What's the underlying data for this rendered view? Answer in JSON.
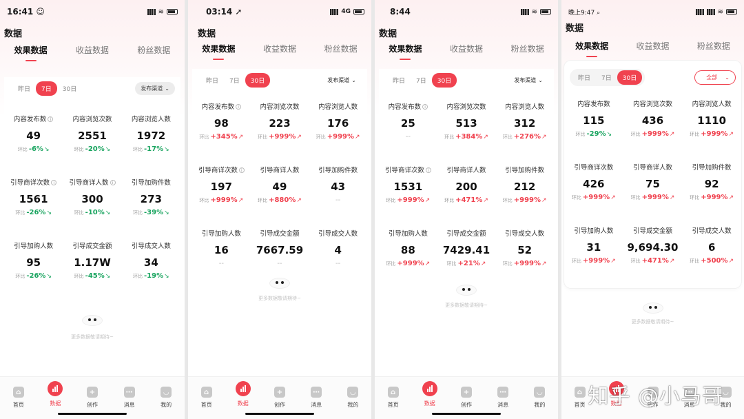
{
  "title": "数据",
  "tabs": [
    "效果数据",
    "收益数据",
    "粉丝数据"
  ],
  "filter_compare_prefix": "环比",
  "more_text": "更多数据敬请期待~",
  "nav": [
    "首页",
    "数据",
    "创作",
    "消息",
    "我的"
  ],
  "range_options": [
    "昨日",
    "7日",
    "30日"
  ],
  "screens": [
    {
      "status_time": "16:41 ☺",
      "network": "",
      "dropdown": "发布渠道",
      "active_range": 1,
      "metrics": [
        {
          "label": "内容发布数",
          "value": "49",
          "change": "-6%",
          "dir": "down",
          "info": true
        },
        {
          "label": "内容浏览次数",
          "value": "2551",
          "change": "-20%",
          "dir": "down",
          "info": false
        },
        {
          "label": "内容浏览人数",
          "value": "1972",
          "change": "-17%",
          "dir": "down",
          "info": false
        },
        {
          "label": "引导商详次数",
          "value": "1561",
          "change": "-26%",
          "dir": "down",
          "info": true
        },
        {
          "label": "引导商详人数",
          "value": "300",
          "change": "-10%",
          "dir": "down",
          "info": true
        },
        {
          "label": "引导加购件数",
          "value": "273",
          "change": "-39%",
          "dir": "down",
          "info": false
        },
        {
          "label": "引导加购人数",
          "value": "95",
          "change": "-26%",
          "dir": "down",
          "info": false
        },
        {
          "label": "引导成交金额",
          "value": "1.17W",
          "change": "-45%",
          "dir": "down",
          "info": false
        },
        {
          "label": "引导成交人数",
          "value": "34",
          "change": "-19%",
          "dir": "down",
          "info": false
        }
      ]
    },
    {
      "status_time": "03:14 ➚",
      "network": "4G",
      "dropdown": "发布渠道",
      "active_range": 2,
      "metrics": [
        {
          "label": "内容发布数",
          "value": "98",
          "change": "+345%",
          "dir": "up",
          "info": true
        },
        {
          "label": "内容浏览次数",
          "value": "223",
          "change": "+999%",
          "dir": "up",
          "info": false
        },
        {
          "label": "内容浏览人数",
          "value": "176",
          "change": "+999%",
          "dir": "up",
          "info": false
        },
        {
          "label": "引导商详次数",
          "value": "197",
          "change": "+999%",
          "dir": "up",
          "info": true
        },
        {
          "label": "引导商详人数",
          "value": "49",
          "change": "+880%",
          "dir": "up",
          "info": false
        },
        {
          "label": "引导加购件数",
          "value": "43",
          "change": "--",
          "dir": "none",
          "info": false
        },
        {
          "label": "引导加购人数",
          "value": "16",
          "change": "--",
          "dir": "none",
          "info": false
        },
        {
          "label": "引导成交金额",
          "value": "7667.59",
          "change": "--",
          "dir": "none",
          "info": false
        },
        {
          "label": "引导成交人数",
          "value": "4",
          "change": "--",
          "dir": "none",
          "info": false
        }
      ]
    },
    {
      "status_time": "8:44",
      "network": "",
      "dropdown": "发布渠道",
      "active_range": 2,
      "metrics": [
        {
          "label": "内容发布数",
          "value": "25",
          "change": "--",
          "dir": "none",
          "info": true
        },
        {
          "label": "内容浏览次数",
          "value": "513",
          "change": "+384%",
          "dir": "up",
          "info": false
        },
        {
          "label": "内容浏览人数",
          "value": "312",
          "change": "+276%",
          "dir": "up",
          "info": false
        },
        {
          "label": "引导商详次数",
          "value": "1531",
          "change": "+999%",
          "dir": "up",
          "info": true
        },
        {
          "label": "引导商详人数",
          "value": "200",
          "change": "+471%",
          "dir": "up",
          "info": false
        },
        {
          "label": "引导加购件数",
          "value": "212",
          "change": "+999%",
          "dir": "up",
          "info": false
        },
        {
          "label": "引导加购人数",
          "value": "88",
          "change": "+999%",
          "dir": "up",
          "info": false
        },
        {
          "label": "引导成交金额",
          "value": "7429.41",
          "change": "+21%",
          "dir": "up",
          "info": false
        },
        {
          "label": "引导成交人数",
          "value": "52",
          "change": "+999%",
          "dir": "up",
          "info": false
        }
      ]
    },
    {
      "status_time": "晚上9:47 ⌕",
      "network": "",
      "dropdown": "全部",
      "active_range": 2,
      "metrics": [
        {
          "label": "内容发布数",
          "value": "115",
          "change": "-29%",
          "dir": "down",
          "info": false
        },
        {
          "label": "内容浏览次数",
          "value": "436",
          "change": "+999%",
          "dir": "up",
          "info": false
        },
        {
          "label": "内容浏览人数",
          "value": "1110",
          "change": "+999%",
          "dir": "up",
          "info": false
        },
        {
          "label": "引导商详次数",
          "value": "426",
          "change": "+999%",
          "dir": "up",
          "info": false
        },
        {
          "label": "引导商详人数",
          "value": "75",
          "change": "+999%",
          "dir": "up",
          "info": false
        },
        {
          "label": "引导加购件数",
          "value": "92",
          "change": "+999%",
          "dir": "up",
          "info": false
        },
        {
          "label": "引导加购人数",
          "value": "31",
          "change": "+999%",
          "dir": "up",
          "info": false
        },
        {
          "label": "引导成交金额",
          "value": "9,694.30",
          "change": "+471%",
          "dir": "up",
          "info": false
        },
        {
          "label": "引导成交人数",
          "value": "6",
          "change": "+500%",
          "dir": "up",
          "info": false
        }
      ]
    }
  ],
  "watermark": "知乎 @小马哥"
}
